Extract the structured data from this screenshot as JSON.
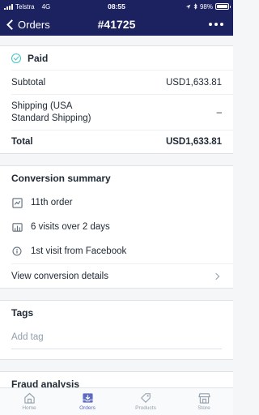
{
  "status_bar": {
    "carrier": "Telstra",
    "network": "4G",
    "time": "08:55",
    "battery": "98%",
    "battery_level": 0.98
  },
  "nav": {
    "back_label": "Orders",
    "title": "#41725"
  },
  "payment": {
    "status": "Paid",
    "subtotal_label": "Subtotal",
    "subtotal_value": "USD1,633.81",
    "shipping_label": "Shipping (USA Standard Shipping)",
    "shipping_value": "–",
    "total_label": "Total",
    "total_value": "USD1,633.81"
  },
  "conversion": {
    "title": "Conversion summary",
    "items": [
      {
        "icon": "order-rank-icon",
        "text": "11th order"
      },
      {
        "icon": "visits-icon",
        "text": "6 visits over 2 days"
      },
      {
        "icon": "info-icon",
        "text": "1st visit from Facebook"
      }
    ],
    "details_link": "View conversion details"
  },
  "tags": {
    "title": "Tags",
    "placeholder": "Add tag"
  },
  "fraud": {
    "title": "Fraud analysis"
  },
  "tab_bar": {
    "tabs": [
      {
        "label": "Home",
        "icon": "home-icon"
      },
      {
        "label": "Orders",
        "icon": "orders-icon",
        "active": true
      },
      {
        "label": "Products",
        "icon": "tag-icon"
      },
      {
        "label": "Store",
        "icon": "store-icon"
      }
    ]
  },
  "colors": {
    "nav_bg": "#1c2260",
    "accent": "#5c6ac4",
    "paid": "#47c1bf"
  }
}
